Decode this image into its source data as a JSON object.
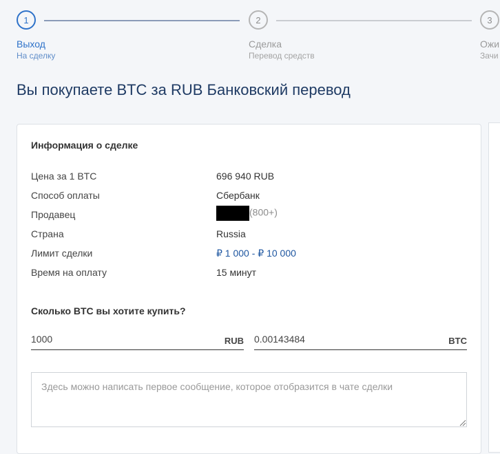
{
  "stepper": {
    "steps": [
      {
        "number": "1",
        "title": "Выход",
        "subtitle": "На сделку",
        "active": true
      },
      {
        "number": "2",
        "title": "Сделка",
        "subtitle": "Перевод средств",
        "active": false
      },
      {
        "number": "3",
        "title": "Ожи",
        "subtitle": "Зачи",
        "active": false
      }
    ]
  },
  "page_title": "Вы покупаете BTC за RUB Банковский перевод",
  "deal_info": {
    "heading": "Информация о сделке",
    "rows": [
      {
        "label": "Цена за 1 BTC",
        "value": "696 940 RUB"
      },
      {
        "label": "Способ оплаты",
        "value": "Сбербанк"
      },
      {
        "label": "Продавец",
        "value": "(800+)"
      },
      {
        "label": "Страна",
        "value": "Russia"
      },
      {
        "label": "Лимит сделки",
        "value": "₽ 1 000 - ₽ 10 000"
      },
      {
        "label": "Время на оплату",
        "value": "15 минут"
      }
    ]
  },
  "purchase": {
    "question": "Сколько BTC вы хотите купить?",
    "rub_value": "1000",
    "rub_unit": "RUB",
    "btc_value": "0.00143484",
    "btc_unit": "BTC"
  },
  "message": {
    "placeholder": "Здесь можно написать первое сообщение, которое отобразится в чате сделки"
  },
  "colors": {
    "accent": "#2e72c9",
    "title": "#1f3b64",
    "limit": "#1e56a0"
  }
}
